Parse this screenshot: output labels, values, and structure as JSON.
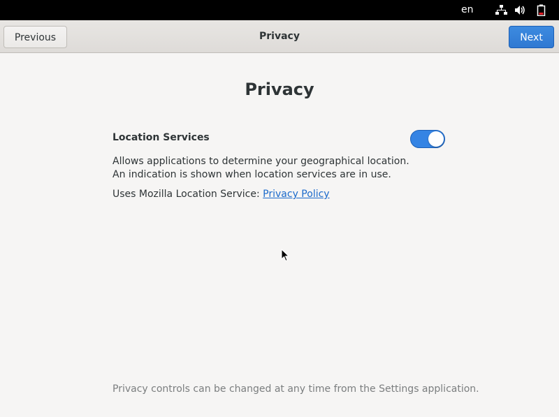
{
  "topbar": {
    "language": "en",
    "icons": [
      "network-wired-icon",
      "volume-icon",
      "battery-icon"
    ]
  },
  "header": {
    "previous_label": "Previous",
    "title": "Privacy",
    "next_label": "Next"
  },
  "main": {
    "title": "Privacy",
    "location_services": {
      "label": "Location Services",
      "enabled": true,
      "description": "Allows applications to determine your geographical location. An indication is shown when location services are in use.",
      "service_prefix": "Uses Mozilla Location Service: ",
      "policy_link": "Privacy Policy"
    },
    "footer_note": "Privacy controls can be changed at any time from the Settings application."
  },
  "colors": {
    "accent": "#3584e4",
    "link": "#1b6acb",
    "background": "#f6f5f4"
  }
}
